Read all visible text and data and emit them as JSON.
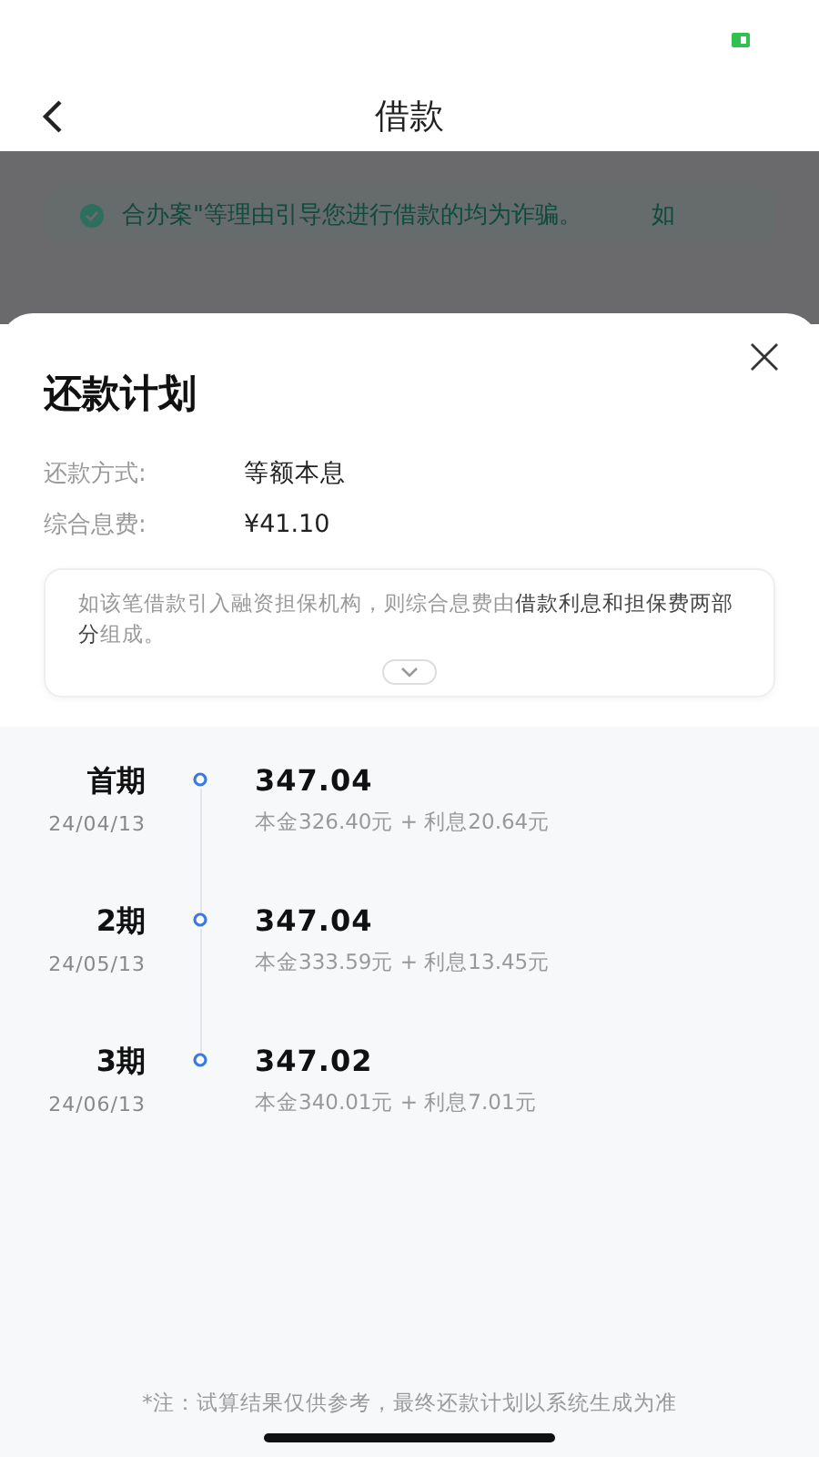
{
  "nav": {
    "title": "借款"
  },
  "background": {
    "notice": "合办案\"等理由引导您进行借款的均为诈骗。",
    "notice_more": "如"
  },
  "sheet": {
    "title": "还款计划",
    "fields": [
      {
        "label": "还款方式:",
        "value": "等额本息"
      },
      {
        "label": "综合息费:",
        "value": "¥41.10"
      }
    ],
    "tip": {
      "text": "如该笔借款引入融资担保机构，则综合息费由**借款利息和担保费两部分**组成。",
      "expanded": false
    },
    "installments": [
      {
        "period": "首期",
        "date": "24/04/13",
        "amount": "347.04",
        "detail": "本金326.40元 + 利息20.64元"
      },
      {
        "period": "2期",
        "date": "24/05/13",
        "amount": "347.04",
        "detail": "本金333.59元 + 利息13.45元"
      },
      {
        "period": "3期",
        "date": "24/06/13",
        "amount": "347.02",
        "detail": "本金340.01元 + 利息7.01元"
      }
    ],
    "footnote": "*注：试算结果仅供参考，最终还款计划以系统生成为准"
  }
}
